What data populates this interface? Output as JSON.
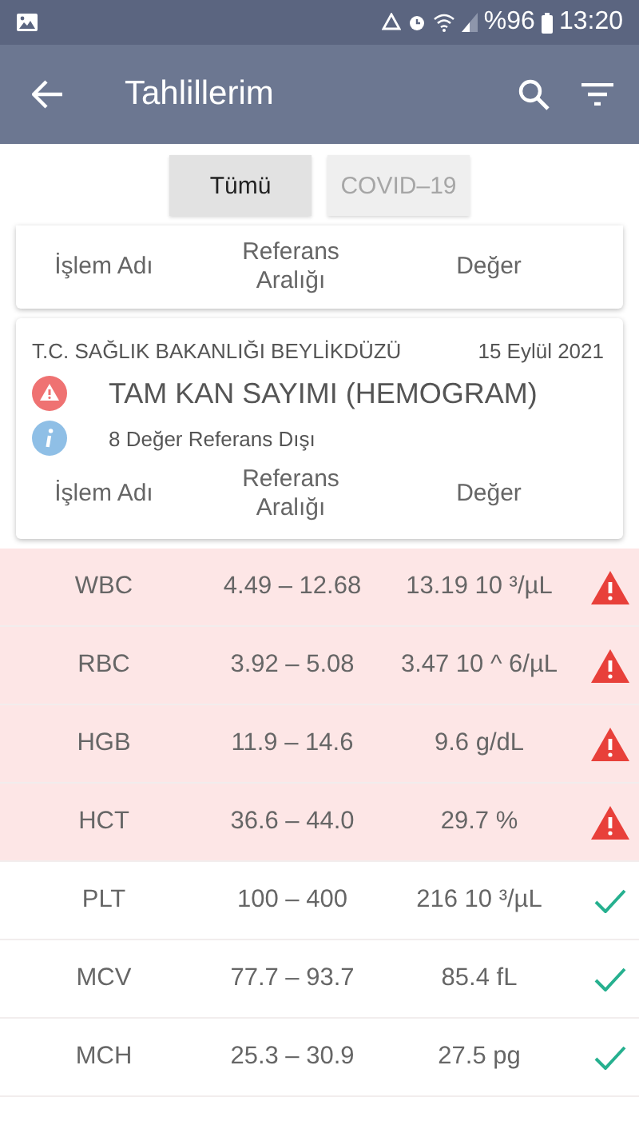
{
  "status_bar": {
    "battery": "%96",
    "time": "13:20"
  },
  "app_bar": {
    "title": "Tahlillerim"
  },
  "tabs": [
    {
      "label": "Tümü",
      "selected": true
    },
    {
      "label": "COVID–19",
      "selected": false
    }
  ],
  "previous_card": {
    "columns": [
      "İşlem Adı",
      "Referans Aralığı",
      "Değer"
    ]
  },
  "card": {
    "institution": "T.C. SAĞLIK BAKANLIĞI BEYLİKDÜZÜ",
    "date": "15 Eylül 2021",
    "title": "TAM KAN SAYIMI (HEMOGRAM)",
    "note": "8 Değer Referans Dışı",
    "columns": [
      "İşlem Adı",
      "Referans Aralığı",
      "Değer"
    ]
  },
  "rows": [
    {
      "name": "WBC",
      "range": "4.49 – 12.68",
      "value": "13.19 10 ³/µL",
      "out_of_range": true
    },
    {
      "name": "RBC",
      "range": "3.92 – 5.08",
      "value": "3.47 10 ^ 6/µL",
      "out_of_range": true
    },
    {
      "name": "HGB",
      "range": "11.9 – 14.6",
      "value": "9.6 g/dL",
      "out_of_range": true
    },
    {
      "name": "HCT",
      "range": "36.6 – 44.0",
      "value": "29.7 %",
      "out_of_range": true
    },
    {
      "name": "PLT",
      "range": "100 – 400",
      "value": "216 10 ³/µL",
      "out_of_range": false
    },
    {
      "name": "MCV",
      "range": "77.7 – 93.7",
      "value": "85.4 fL",
      "out_of_range": false
    },
    {
      "name": "MCH",
      "range": "25.3 – 30.9",
      "value": "27.5 pg",
      "out_of_range": false
    }
  ]
}
